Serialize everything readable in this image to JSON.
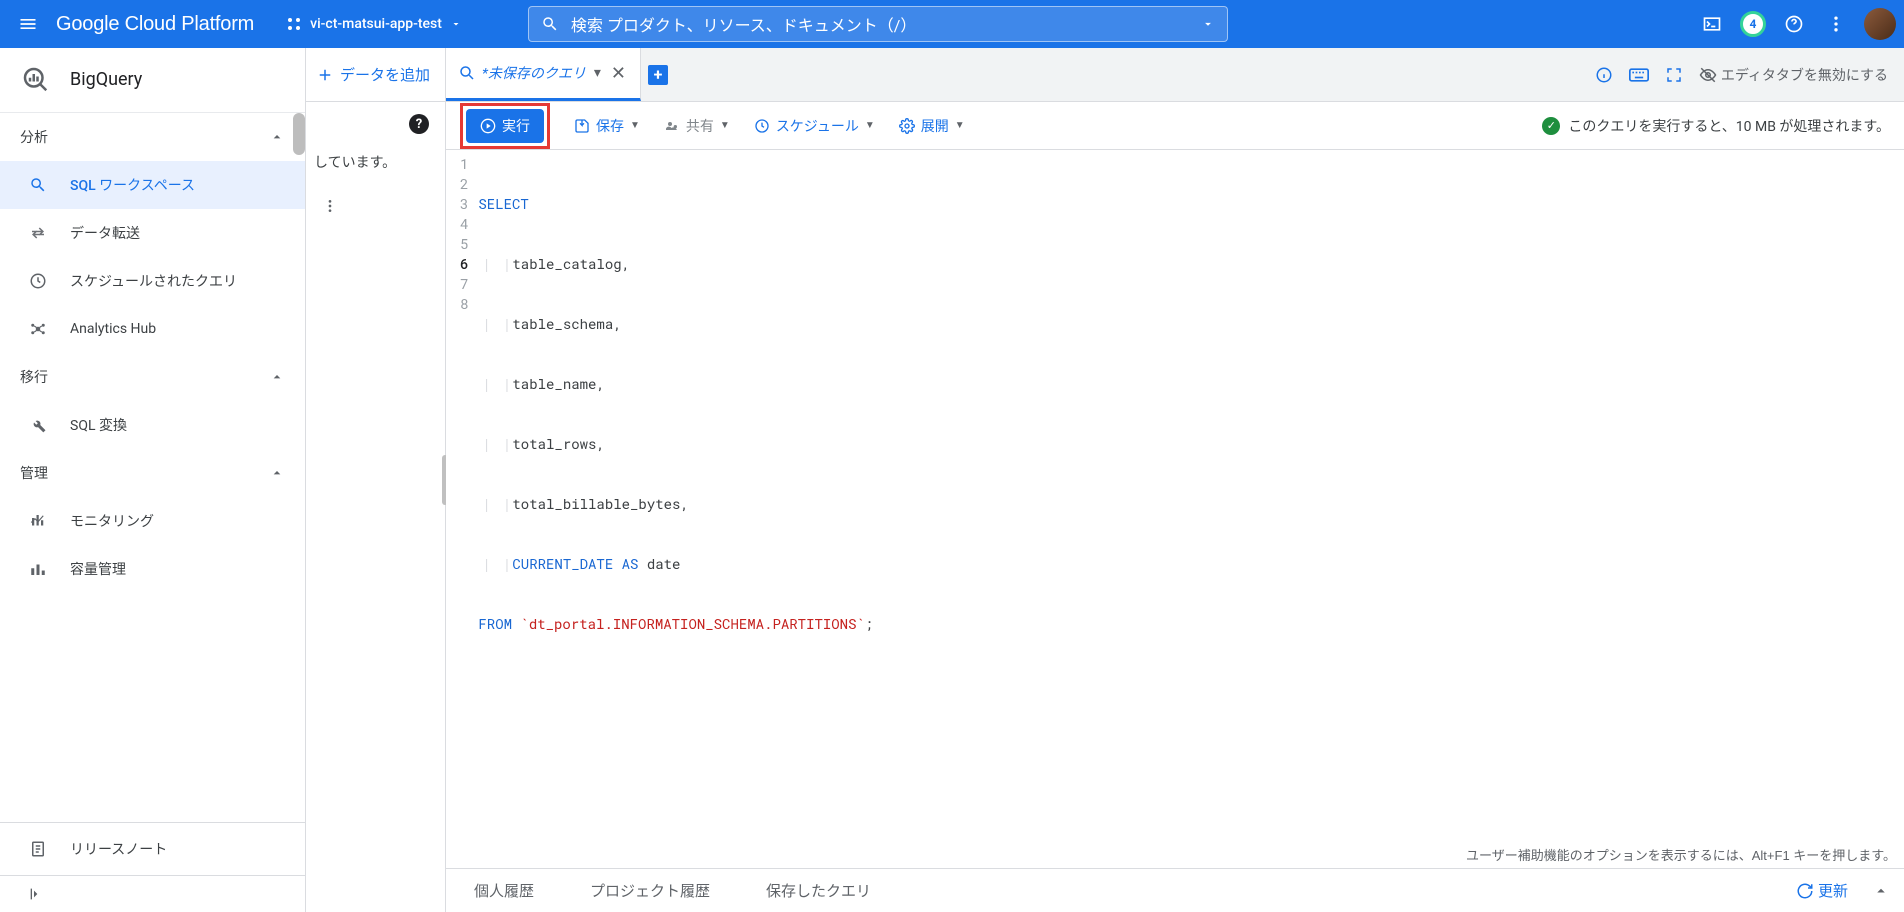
{
  "header": {
    "logo": "Google Cloud Platform",
    "project": "vi-ct-matsui-app-test",
    "search_placeholder": "検索  プロダクト、リソース、ドキュメント（/）",
    "badge": "4"
  },
  "sidebar": {
    "product": "BigQuery",
    "groups": {
      "g1": {
        "title": "分析"
      },
      "g2": {
        "title": "移行"
      },
      "g3": {
        "title": "管理"
      }
    },
    "items": {
      "sqlws": "SQL ワークスペース",
      "transfer": "データ転送",
      "scheduled": "スケジュールされたクエリ",
      "ahub": "Analytics Hub",
      "sqlconv": "SQL 変換",
      "monitoring": "モニタリング",
      "capacity": "容量管理",
      "release": "リリースノート"
    }
  },
  "midcol": {
    "add_data": "データを追加",
    "status_text": "しています。"
  },
  "tabs": {
    "active_label": "*未保存のクエリ",
    "disable_tabs": "エディタタブを無効にする"
  },
  "toolbar": {
    "run": "実行",
    "save": "保存",
    "share": "共有",
    "schedule": "スケジュール",
    "deploy": "展開",
    "status": "このクエリを実行すると、10 MB が処理されます。"
  },
  "editor": {
    "lines": {
      "l1_kw": "SELECT",
      "l2": "table_catalog,",
      "l3": "table_schema,",
      "l4": "table_name,",
      "l5": "total_rows,",
      "l6": "total_billable_bytes,",
      "l7a": "CURRENT_DATE",
      "l7b": " AS ",
      "l7c": "date",
      "l8a": "FROM",
      "l8b": "`dt_portal.INFORMATION_SCHEMA.PARTITIONS`",
      "l8c": ";"
    },
    "a11y": "ユーザー補助機能のオプションを表示するには、Alt+F1 キーを押します。"
  },
  "bottombar": {
    "personal": "個人履歴",
    "project": "プロジェクト履歴",
    "saved": "保存したクエリ",
    "refresh": "更新"
  }
}
